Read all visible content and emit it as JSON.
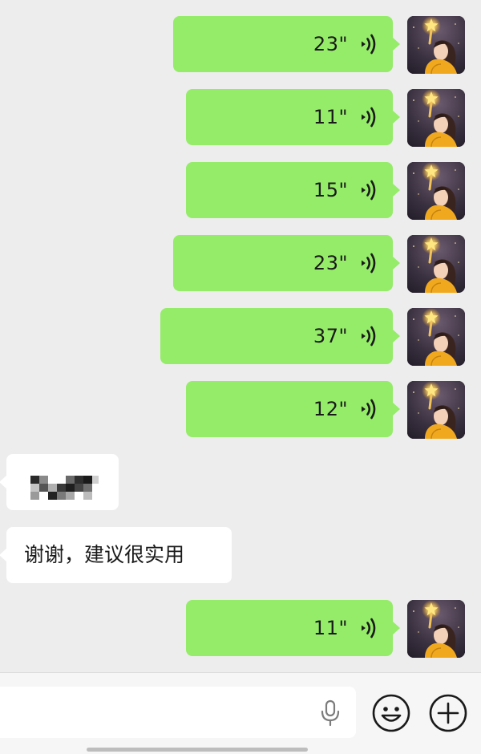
{
  "messages": [
    {
      "kind": "voice",
      "duration": "23\""
    },
    {
      "kind": "voice",
      "duration": "11\""
    },
    {
      "kind": "voice",
      "duration": "15\""
    },
    {
      "kind": "voice",
      "duration": "23\""
    },
    {
      "kind": "voice",
      "duration": "37\""
    },
    {
      "kind": "voice",
      "duration": "12\""
    },
    {
      "kind": "text_redacted"
    },
    {
      "kind": "text",
      "text": "谢谢，建议很实用"
    },
    {
      "kind": "voice",
      "duration": "11\""
    }
  ],
  "input_bar": {
    "icons": [
      "microphone-icon",
      "emoji-icon",
      "plus-icon"
    ],
    "input_value": ""
  },
  "colors": {
    "background": "#ededed",
    "outgoing_bubble": "#95ec69",
    "incoming_bubble": "#ffffff",
    "input_bar": "#f6f6f6"
  }
}
